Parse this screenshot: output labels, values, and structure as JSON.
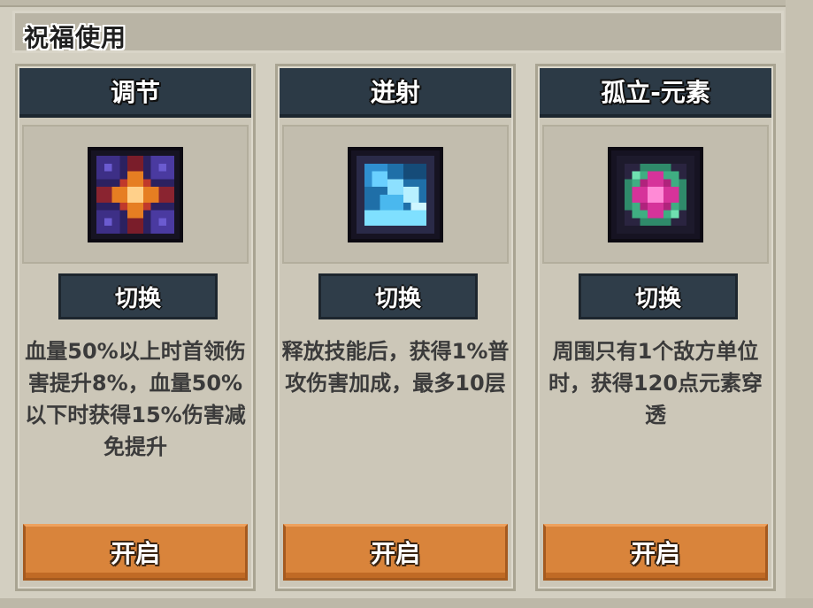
{
  "header": {
    "title": "祝福使用"
  },
  "cards": [
    {
      "title": "调节",
      "icon": "regulate-blessing-icon",
      "switch_label": "切换",
      "description": "血量50%以上时首领伤害提升8%，血量50%以下时获得15%伤害减免提升",
      "open_label": "开启"
    },
    {
      "title": "迸射",
      "icon": "burst-blessing-icon",
      "switch_label": "切换",
      "description": "释放技能后，获得1%普攻伤害加成，最多10层",
      "open_label": "开启"
    },
    {
      "title": "孤立-元素",
      "icon": "isolation-element-blessing-icon",
      "switch_label": "切换",
      "description": "周围只有1个敌方单位时，获得120点元素穿透",
      "open_label": "开启"
    }
  ],
  "colors": {
    "title_bar": "#2c3a46",
    "switch_button": "#2f3d49",
    "open_button": "#d9843b",
    "panel_bg": "#ccc7b8"
  }
}
